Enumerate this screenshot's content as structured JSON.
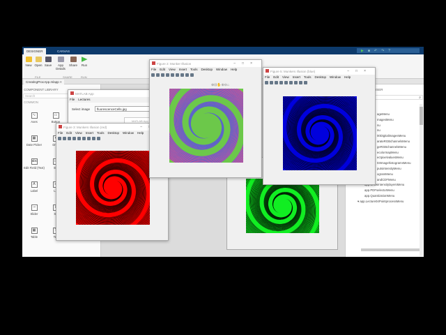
{
  "tabs": [
    "DESIGNER",
    "CANVAS"
  ],
  "toolstrip": {
    "buttons": [
      "New",
      "Open",
      "Save",
      "App Details",
      "Share",
      "Run"
    ],
    "sections": [
      "FILE",
      "SHARE",
      "RUN"
    ]
  },
  "document_tab": "CreatingProcApp.mlapp",
  "library": {
    "title": "COMPONENT LIBRARY",
    "search_placeholder": "Search",
    "section": "COMMON",
    "components": [
      "Axes",
      "Button",
      "Date Picker",
      "Drop",
      "Edit Field (Text)",
      "Ed",
      "Label",
      "Lis",
      "Slider",
      "Sp",
      "Table",
      "Tex"
    ]
  },
  "browser": {
    "title": "WSER",
    "items": [
      "ageMenu",
      "magesMenu",
      "nu",
      "nu",
      "00DigitalimagesMenu",
      "arateRGBchannelsMenu",
      "geRGBchannelsMenu",
      "ecolormapMenu",
      "ectpixelvaluesMenu",
      "03ImagehistogramsMenu",
      "putsintensityMenu",
      "ogramMenu",
      "andCDFMenu",
      "app.ShowIntensitylayersMenu",
      "app.PDFselectorMenu",
      "app.QuantizationMenu",
      "▾ app.Lecture04PointprocessMenu"
    ]
  },
  "matlab_app": {
    "title": "MATLAB App",
    "menu": [
      "File",
      "Lectures"
    ],
    "select_label": "Select image",
    "select_value": "fluorescenceCells.jpg",
    "second_title": "MATLAB App"
  },
  "fig_menu": [
    "File",
    "Edit",
    "View",
    "Insert",
    "Tools",
    "Desktop",
    "Window",
    "Help"
  ],
  "fig3": {
    "title": "Figure 3: Munkers Illusion (red)"
  },
  "fig2": {
    "title": "Figure 2: Munker Illusion"
  },
  "fig5": {
    "title": "Figure 5: Munkers Illusion (blue)"
  },
  "colors": {
    "red": "#ff0000",
    "blue": "#0000dd",
    "green": "#11ee22",
    "pink": "#e8508a",
    "marker_green": "#6cc84a"
  }
}
